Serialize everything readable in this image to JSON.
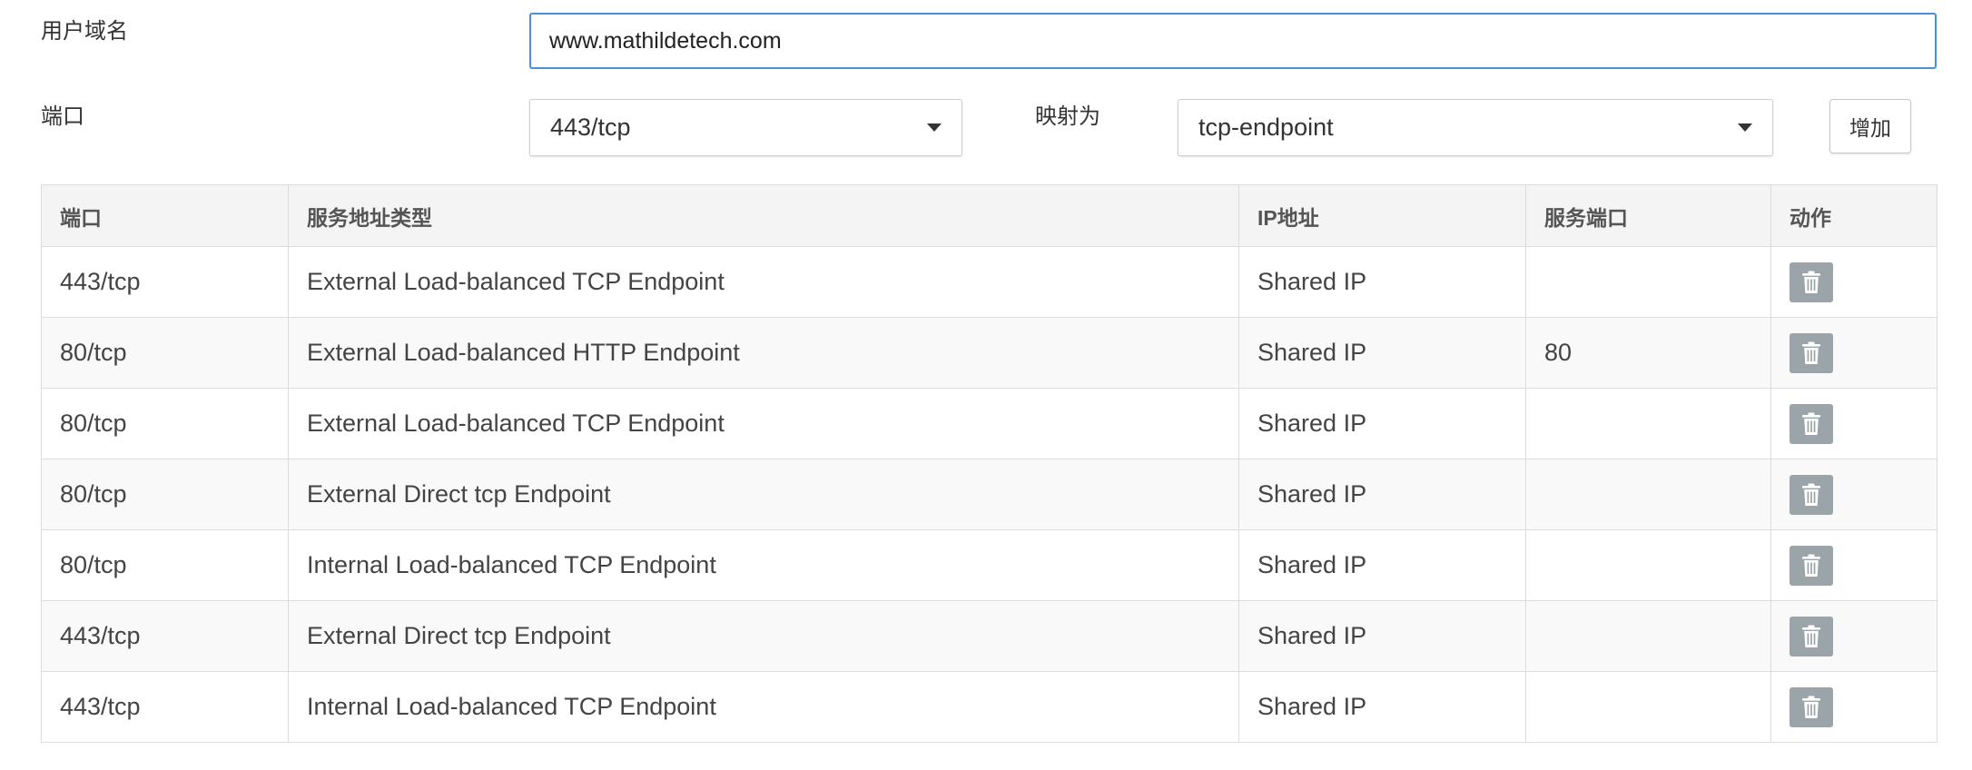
{
  "form": {
    "domain_label": "用户域名",
    "domain_value": "www.mathildetech.com",
    "port_label": "端口",
    "port_selected": "443/tcp",
    "map_label": "映射为",
    "map_selected": "tcp-endpoint",
    "add_button_label": "增加"
  },
  "table": {
    "headers": {
      "port": "端口",
      "service_addr_type": "服务地址类型",
      "ip": "IP地址",
      "service_port": "服务端口",
      "action": "动作"
    },
    "rows": [
      {
        "port": "443/tcp",
        "type": "External Load-balanced TCP Endpoint",
        "ip": "Shared IP",
        "service_port": ""
      },
      {
        "port": "80/tcp",
        "type": "External Load-balanced HTTP Endpoint",
        "ip": "Shared IP",
        "service_port": "80"
      },
      {
        "port": "80/tcp",
        "type": "External Load-balanced TCP Endpoint",
        "ip": "Shared IP",
        "service_port": ""
      },
      {
        "port": "80/tcp",
        "type": "External Direct tcp Endpoint",
        "ip": "Shared IP",
        "service_port": ""
      },
      {
        "port": "80/tcp",
        "type": "Internal Load-balanced TCP Endpoint",
        "ip": "Shared IP",
        "service_port": ""
      },
      {
        "port": "443/tcp",
        "type": "External Direct tcp Endpoint",
        "ip": "Shared IP",
        "service_port": ""
      },
      {
        "port": "443/tcp",
        "type": "Internal Load-balanced TCP Endpoint",
        "ip": "Shared IP",
        "service_port": ""
      }
    ],
    "action_icon": "trash-icon"
  },
  "colors": {
    "input_focus_border": "#4a90d9",
    "trash_button_bg": "#9aa4a9",
    "header_bg": "#f4f4f4"
  }
}
